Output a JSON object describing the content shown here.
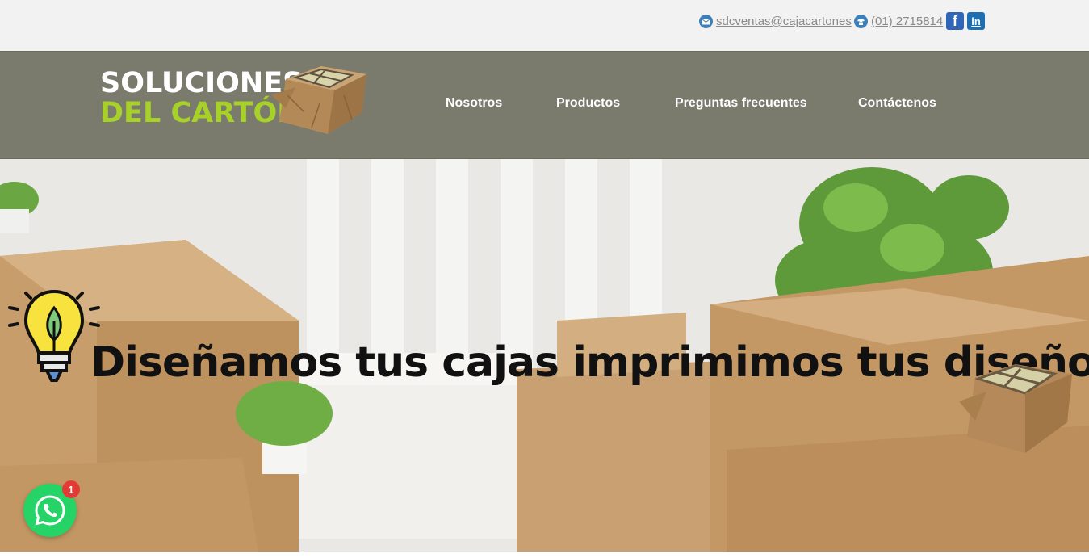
{
  "topbar": {
    "email": "sdcventas@cajacartones",
    "phone": "(01) 2715814",
    "email_icon": "envelope-icon",
    "phone_icon": "telephone-icon",
    "facebook_icon": "facebook-icon",
    "linkedin_icon": "linkedin-icon"
  },
  "header": {
    "logo_line1": "SOLUCIONES",
    "logo_line2": "DEL CARTÓN",
    "nav": [
      "Nosotros",
      "Productos",
      "Preguntas frecuentes",
      "Contáctenos"
    ]
  },
  "hero": {
    "title": "Diseñamos tus cajas imprimimos tus diseños"
  },
  "whatsapp": {
    "badge_count": "1",
    "icon": "whatsapp-icon"
  },
  "colors": {
    "header_bg": "#7a7b6c",
    "logo_green": "#a7d129",
    "whatsapp_green": "#25d366",
    "badge_red": "#e53935"
  }
}
